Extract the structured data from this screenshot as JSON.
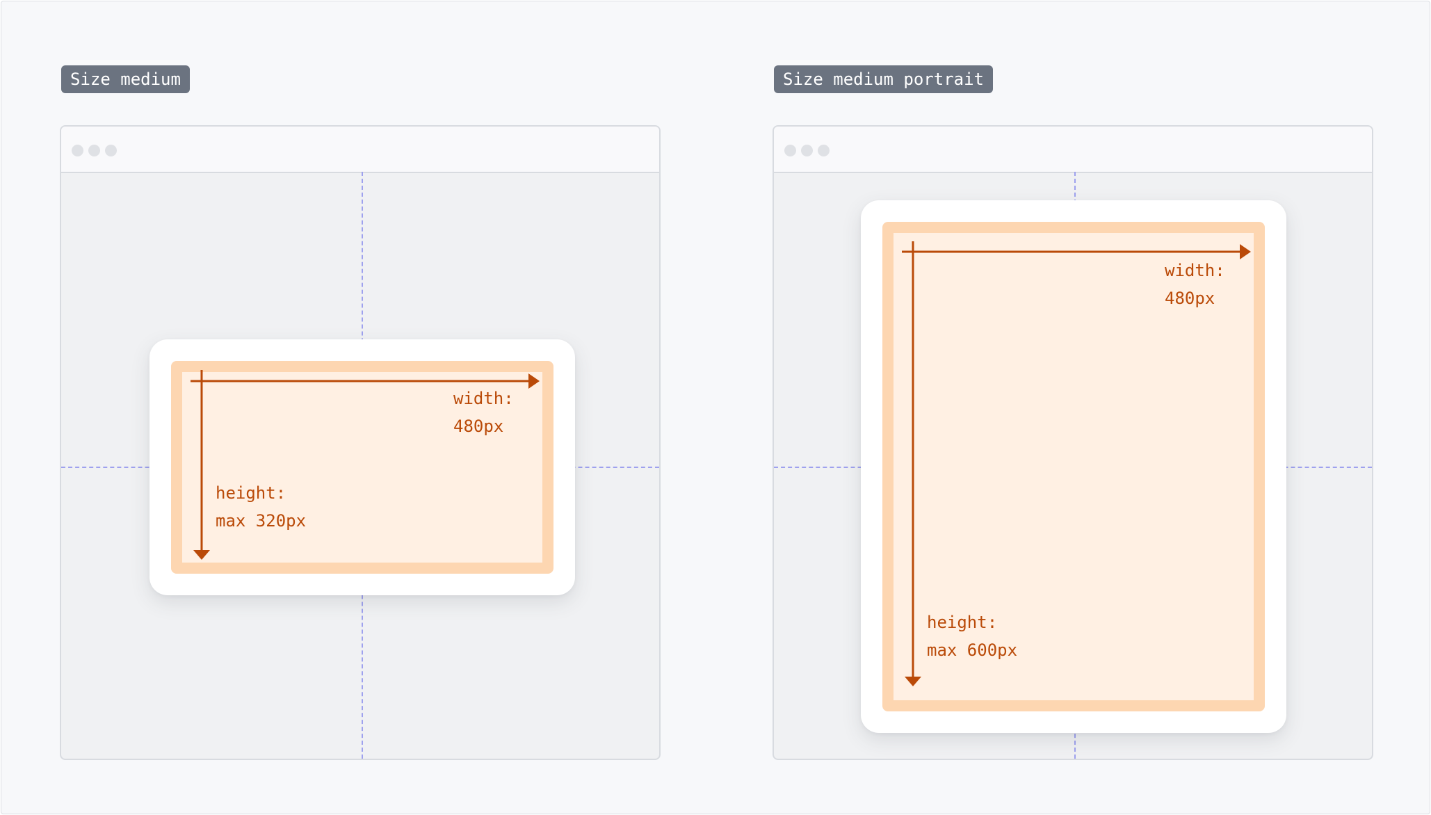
{
  "panels": [
    {
      "badge": "Size medium",
      "width_label": "width:",
      "width_value": "480px",
      "height_label": "height:",
      "height_value": "max 320px"
    },
    {
      "badge": "Size medium portrait",
      "width_label": "width:",
      "width_value": "480px",
      "height_label": "height:",
      "height_value": "max 600px"
    }
  ],
  "colors": {
    "page_background": "#f7f8fa",
    "badge_background": "#6b7380",
    "window_background": "#f0f1f3",
    "guide_line": "#9ea1ee",
    "area_fill": "#fff0e3",
    "area_border": "#fdd6b1",
    "arrow_and_label": "#ba4a08"
  }
}
